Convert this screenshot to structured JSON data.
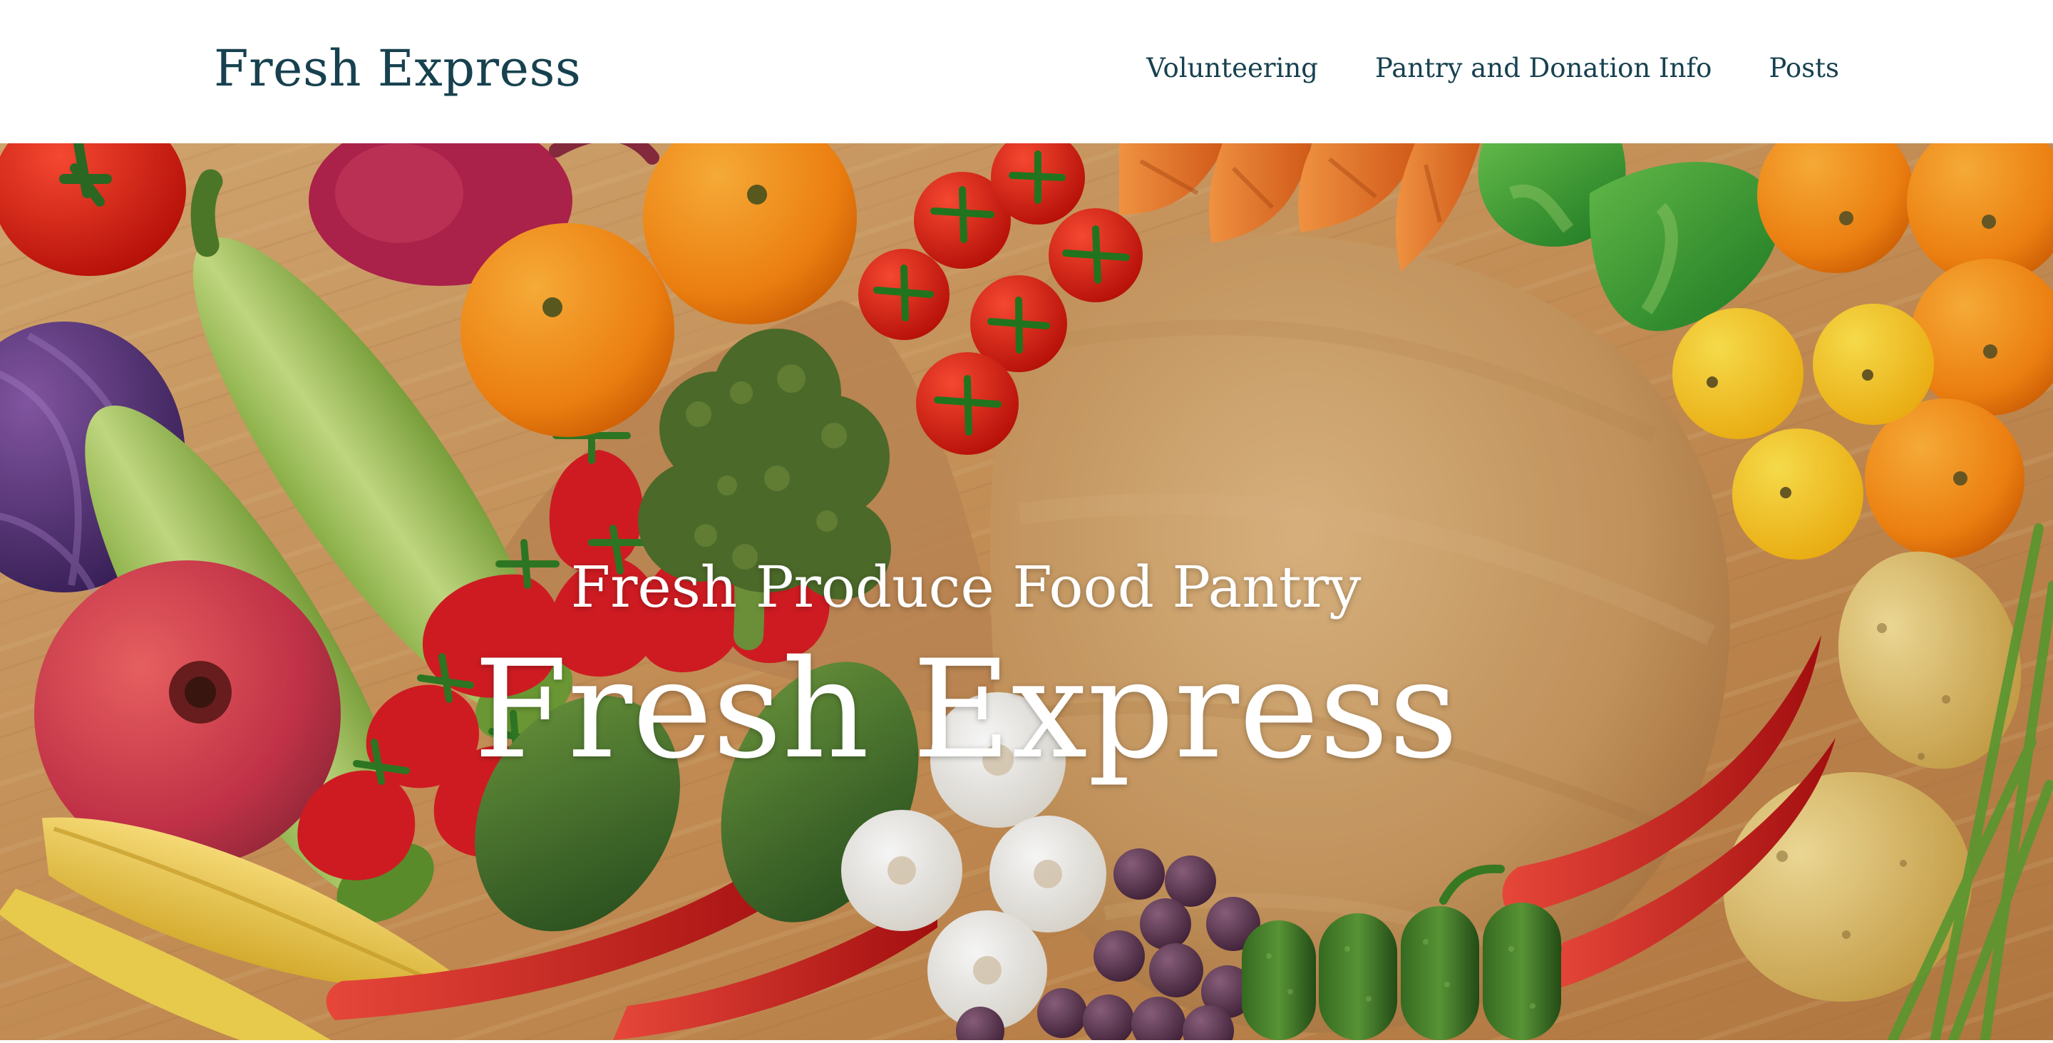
{
  "header": {
    "brand": "Fresh Express",
    "nav": [
      {
        "label": "Volunteering"
      },
      {
        "label": "Pantry and Donation Info"
      },
      {
        "label": "Posts"
      }
    ]
  },
  "hero": {
    "subtitle": "Fresh Produce Food Pantry",
    "title": "Fresh Express",
    "image_subject": "assorted fresh fruits and vegetables around a round wooden cutting board"
  },
  "colors": {
    "brand_text": "#17414f",
    "hero_text": "#ffffff",
    "header_bg": "#ffffff"
  }
}
